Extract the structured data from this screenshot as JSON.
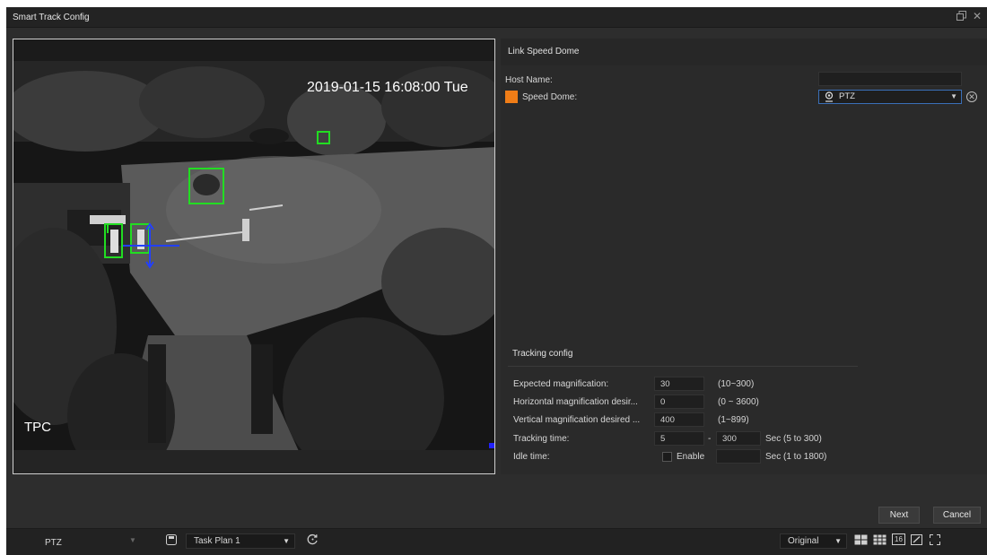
{
  "window": {
    "title": "Smart Track Config",
    "restore_icon": "restore-window-icon",
    "close_icon": "close-icon"
  },
  "video": {
    "osd_time": "2019-01-15 16:08:00 Tue",
    "osd_label": "TPC",
    "detection_box_color": "#22dd22",
    "tracking_line_color": "#2240ff"
  },
  "link_speed_dome": {
    "heading": "Link Speed Dome",
    "host_name_label": "Host Name:",
    "host_name_value": "",
    "speed_dome_label": "Speed Dome:",
    "speed_dome_color": "#f07d17",
    "speed_dome_selected": "PTZ"
  },
  "tracking_config": {
    "heading": "Tracking config",
    "expected_magnification": {
      "label": "Expected magnification:",
      "value": "30",
      "range": "(10~300)"
    },
    "horizontal_magnification": {
      "label": "Horizontal magnification desir...",
      "value": "0",
      "range": "(0 ~ 3600)"
    },
    "vertical_magnification": {
      "label": "Vertical magnification desired ...",
      "value": "400",
      "range": "(1~899)"
    },
    "tracking_time": {
      "label": "Tracking time:",
      "min": "5",
      "separator": "-",
      "max": "300",
      "range": "Sec (5 to 300)"
    },
    "idle_time": {
      "label": "Idle time:",
      "enable_label": "Enable",
      "enabled": false,
      "value": "",
      "range": "Sec (1 to 1800)"
    }
  },
  "buttons": {
    "next": "Next",
    "cancel": "Cancel"
  },
  "bottom_bar": {
    "ptz_label": "PTZ",
    "task_plan": "Task Plan 1",
    "view_mode": "Original",
    "layout_16": "16"
  }
}
